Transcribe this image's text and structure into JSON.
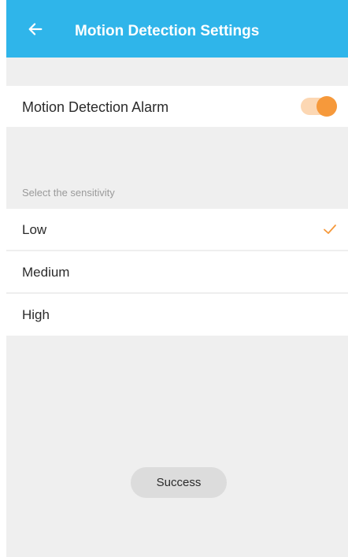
{
  "header": {
    "title": "Motion Detection Settings",
    "back_icon": "arrow-left-icon",
    "background_color": "#2fb5ea"
  },
  "alarm": {
    "label": "Motion Detection Alarm",
    "enabled": true,
    "accent_color": "#f6993b"
  },
  "sensitivity": {
    "section_label": "Select the sensitivity",
    "options": [
      {
        "label": "Low",
        "selected": true
      },
      {
        "label": "Medium",
        "selected": false
      },
      {
        "label": "High",
        "selected": false
      }
    ],
    "check_icon": "checkmark-icon",
    "check_color": "#f6993b"
  },
  "toast": {
    "message": "Success"
  }
}
